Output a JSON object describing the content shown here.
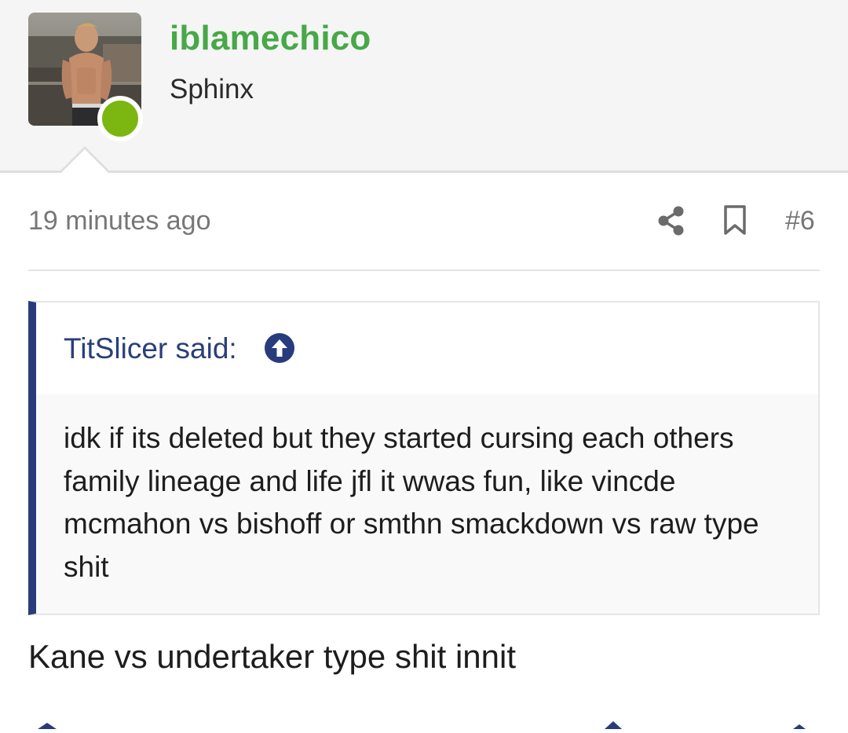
{
  "user": {
    "username": "iblamechico",
    "title": "Sphinx",
    "avatar_icon": "user-avatar-photo",
    "status": "online",
    "status_color": "#7cb610"
  },
  "post": {
    "timestamp": "19 minutes ago",
    "post_number": "#6",
    "share_icon": "share-icon",
    "bookmark_icon": "bookmark-icon"
  },
  "quote": {
    "author_label": "TitSlicer said:",
    "jump_icon": "arrow-up-circle-icon",
    "body": "idk if its deleted but they started cursing each others family lineage and life jfl it wwas fun, like vincde mcmahon vs bishoff or smthn smackdown vs raw type shit"
  },
  "reply": {
    "text": "Kane vs undertaker type shit innit"
  },
  "colors": {
    "username": "#47a847",
    "quote_accent": "#283c7c",
    "meta_text": "#777777"
  }
}
